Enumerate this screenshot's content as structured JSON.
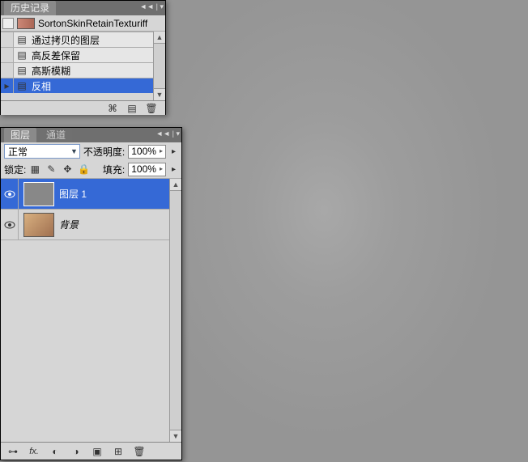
{
  "history": {
    "title": "历史记录",
    "source_name": "SortonSkinRetainTexturiff",
    "steps": [
      {
        "label": "通过拷贝的图层",
        "selected": false
      },
      {
        "label": "高反差保留",
        "selected": false
      },
      {
        "label": "高斯模糊",
        "selected": false
      },
      {
        "label": "反相",
        "selected": true
      }
    ]
  },
  "layers": {
    "tabs": {
      "layers": "图层",
      "channels": "通道"
    },
    "blend_mode": "正常",
    "opacity_label": "不透明度:",
    "opacity_value": "100%",
    "lock_label": "锁定:",
    "fill_label": "填充:",
    "fill_value": "100%",
    "items": [
      {
        "name": "图层 1",
        "selected": true,
        "locked": false,
        "bg": false
      },
      {
        "name": "背景",
        "selected": false,
        "locked": true,
        "bg": true
      }
    ]
  },
  "icons": {
    "eye": "●",
    "link": "⊶",
    "fx": "fx.",
    "mask": "◐",
    "adj": "◑",
    "folder": "▣",
    "new": "⊞",
    "trash": "🗑",
    "cam": "⌘",
    "doc": "▤",
    "lock": "🔒"
  }
}
